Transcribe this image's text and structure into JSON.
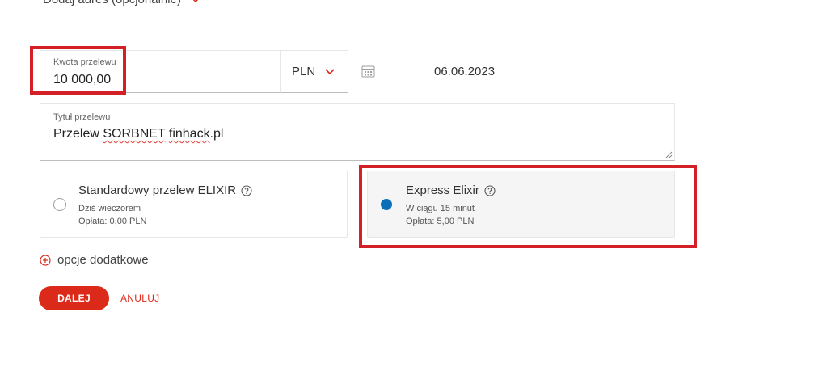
{
  "address": {
    "label": "Dodaj adres (opcjonalnie)",
    "icon": "chevron-down-icon"
  },
  "amount": {
    "label": "Kwota przelewu",
    "value": "10 000,00"
  },
  "currency": {
    "value": "PLN",
    "icon": "chevron-down-icon"
  },
  "date": {
    "icon": "calendar-icon",
    "value": "06.06.2023"
  },
  "transfer_title": {
    "label": "Tytuł przelewu",
    "prefix": "Przelew ",
    "word1": "SORBNET",
    "space": " ",
    "word2": "finhack",
    "suffix": ".pl"
  },
  "options": {
    "standard": {
      "title": "Standardowy przelew ELIXIR",
      "timing": "Dziś wieczorem",
      "fee": "Opłata: 0,00 PLN",
      "selected": false
    },
    "express": {
      "title": "Express Elixir",
      "timing": "W ciągu 15 minut",
      "fee": "Opłata: 5,00 PLN",
      "selected": true
    }
  },
  "additional_options": {
    "label": "opcje dodatkowe",
    "icon": "plus-circle-icon"
  },
  "actions": {
    "next": "DALEJ",
    "cancel": "ANULUJ"
  },
  "colors": {
    "accent": "#dc2a1a",
    "radio_selected": "#0b6fb8",
    "highlight": "#d32027"
  }
}
